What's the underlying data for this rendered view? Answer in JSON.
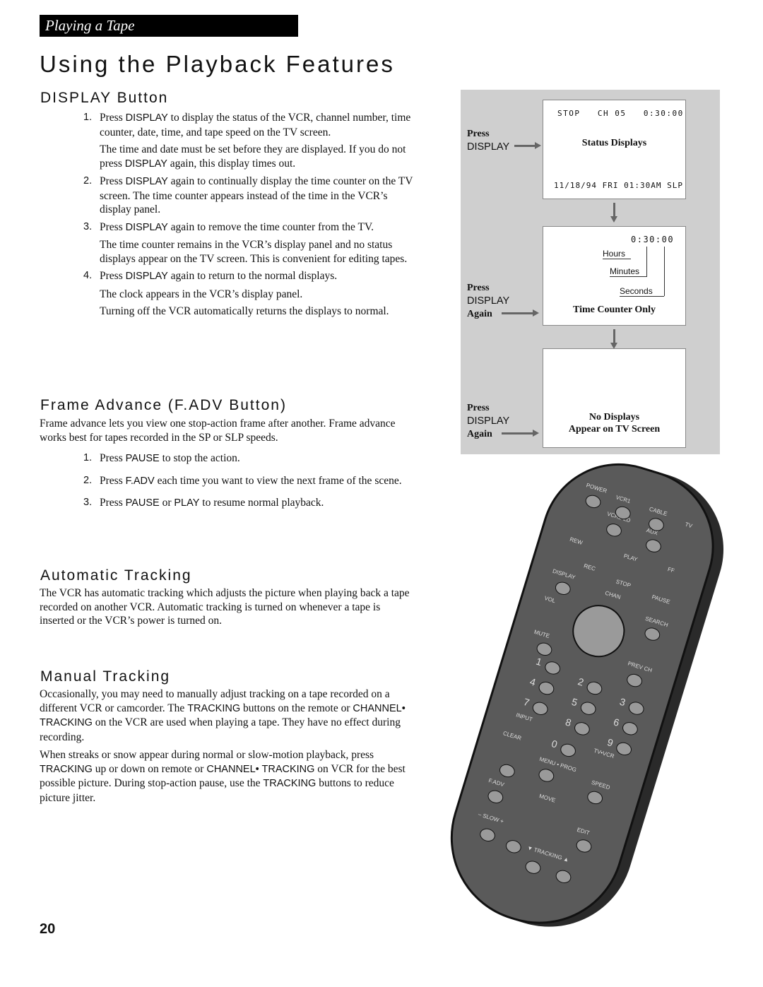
{
  "header": "Playing a Tape",
  "title": "Using the Playback Features",
  "display_section": {
    "heading": "DISPLAY Button",
    "steps": [
      {
        "n": "1.",
        "pre": "Press ",
        "key": "DISPLAY",
        "post": " to display the status of the VCR, channel number, time counter, date, time, and tape speed on the TV screen.",
        "note_pre": "The time and date must be set before they are displayed.  If you do not press ",
        "note_key": "DISPLAY",
        "note_post": " again, this display times out."
      },
      {
        "n": "2.",
        "pre": "Press ",
        "key": "DISPLAY",
        "post": " again to continually display the time counter on the TV screen.  The time counter appears instead of the time in the VCR’s display panel."
      },
      {
        "n": "3.",
        "pre": "Press ",
        "key": "DISPLAY",
        "post": " again to remove the time counter from the TV.",
        "note": "The time counter remains in the VCR’s display panel and no status displays appear on the TV screen.  This is convenient for editing tapes."
      },
      {
        "n": "4.",
        "pre": "Press ",
        "key": "DISPLAY",
        "post": " again to return to the normal displays.",
        "note": "The clock appears in the VCR’s display panel.",
        "note2": "Turning off the VCR automatically returns the displays to normal."
      }
    ]
  },
  "frame_section": {
    "heading": "Frame Advance (F.ADV Button)",
    "intro": "Frame advance lets you view one stop-action frame after another.  Frame advance works best for tapes recorded in the SP or SLP speeds.",
    "steps": [
      {
        "n": "1.",
        "pre": "Press ",
        "key": "PAUSE",
        "post": " to stop the action."
      },
      {
        "n": "2.",
        "pre": "Press ",
        "key": "F.ADV",
        "post": " each time you want to view the next frame of the scene."
      },
      {
        "n": "3.",
        "pre": "Press ",
        "key": "PAUSE",
        "mid": " or ",
        "key2": "PLAY",
        "post": " to resume normal playback."
      }
    ]
  },
  "auto_section": {
    "heading": "Automatic Tracking",
    "text": "The VCR has automatic tracking which adjusts the picture when playing back a tape recorded on another VCR.  Automatic tracking is turned on whenever a tape is inserted or the VCR’s power is turned on."
  },
  "manual_section": {
    "heading": "Manual Tracking",
    "p1a": "Occasionally, you may need to manually adjust tracking on a tape recorded on a different VCR or camcorder.  The ",
    "p1k1": "TRACKING",
    "p1b": " buttons on the remote or ",
    "p1k2": "CHANNEL• TRACKING",
    "p1c": " on the VCR are used when playing a tape.  They have no effect during recording.",
    "p2a": "When streaks or snow appear during normal or slow-motion playback, press ",
    "p2k1": "TRACKING",
    "p2b": " up or down on remote or ",
    "p2k2": "CHANNEL• TRACKING",
    "p2c": " on VCR for the best possible picture.  During stop-action pause, use the ",
    "p2k3": "TRACKING",
    "p2d": " buttons to reduce picture jitter."
  },
  "diagram": {
    "screen1": {
      "top": "STOP   CH 05   0:30:00",
      "caption": "Status Displays",
      "bottom": "11/18/94 FRI 01:30AM SLP",
      "press": "Press",
      "key": "DISPLAY"
    },
    "screen2": {
      "counter": "0:30:00",
      "hours": "Hours",
      "minutes": "Minutes",
      "seconds": "Seconds",
      "caption": "Time Counter Only",
      "press": "Press",
      "key": "DISPLAY",
      "again": "Again"
    },
    "screen3": {
      "caption1": "No Displays",
      "caption2": "Appear on TV Screen",
      "press": "Press",
      "key": "DISPLAY",
      "again": "Again"
    }
  },
  "remote": {
    "labels": [
      "POWER",
      "VCR1",
      "CABLE",
      "TV",
      "VCR2•LD",
      "AUX",
      "REW",
      "PLAY",
      "FF",
      "REC",
      "STOP",
      "PAUSE",
      "DISPLAY",
      "CHAN",
      "SEARCH",
      "VOL",
      "MUTE",
      "PREV CH",
      "INPUT",
      "CLEAR",
      "TV•VCR",
      "MENU • PROG",
      "SPEED",
      "F.ADV",
      "MOVE",
      "EDIT",
      "–  SLOW  +",
      "▼ TRACKING ▲"
    ],
    "digits": [
      "1",
      "2",
      "3",
      "4",
      "5",
      "6",
      "7",
      "8",
      "9",
      "0"
    ]
  },
  "page_number": "20"
}
